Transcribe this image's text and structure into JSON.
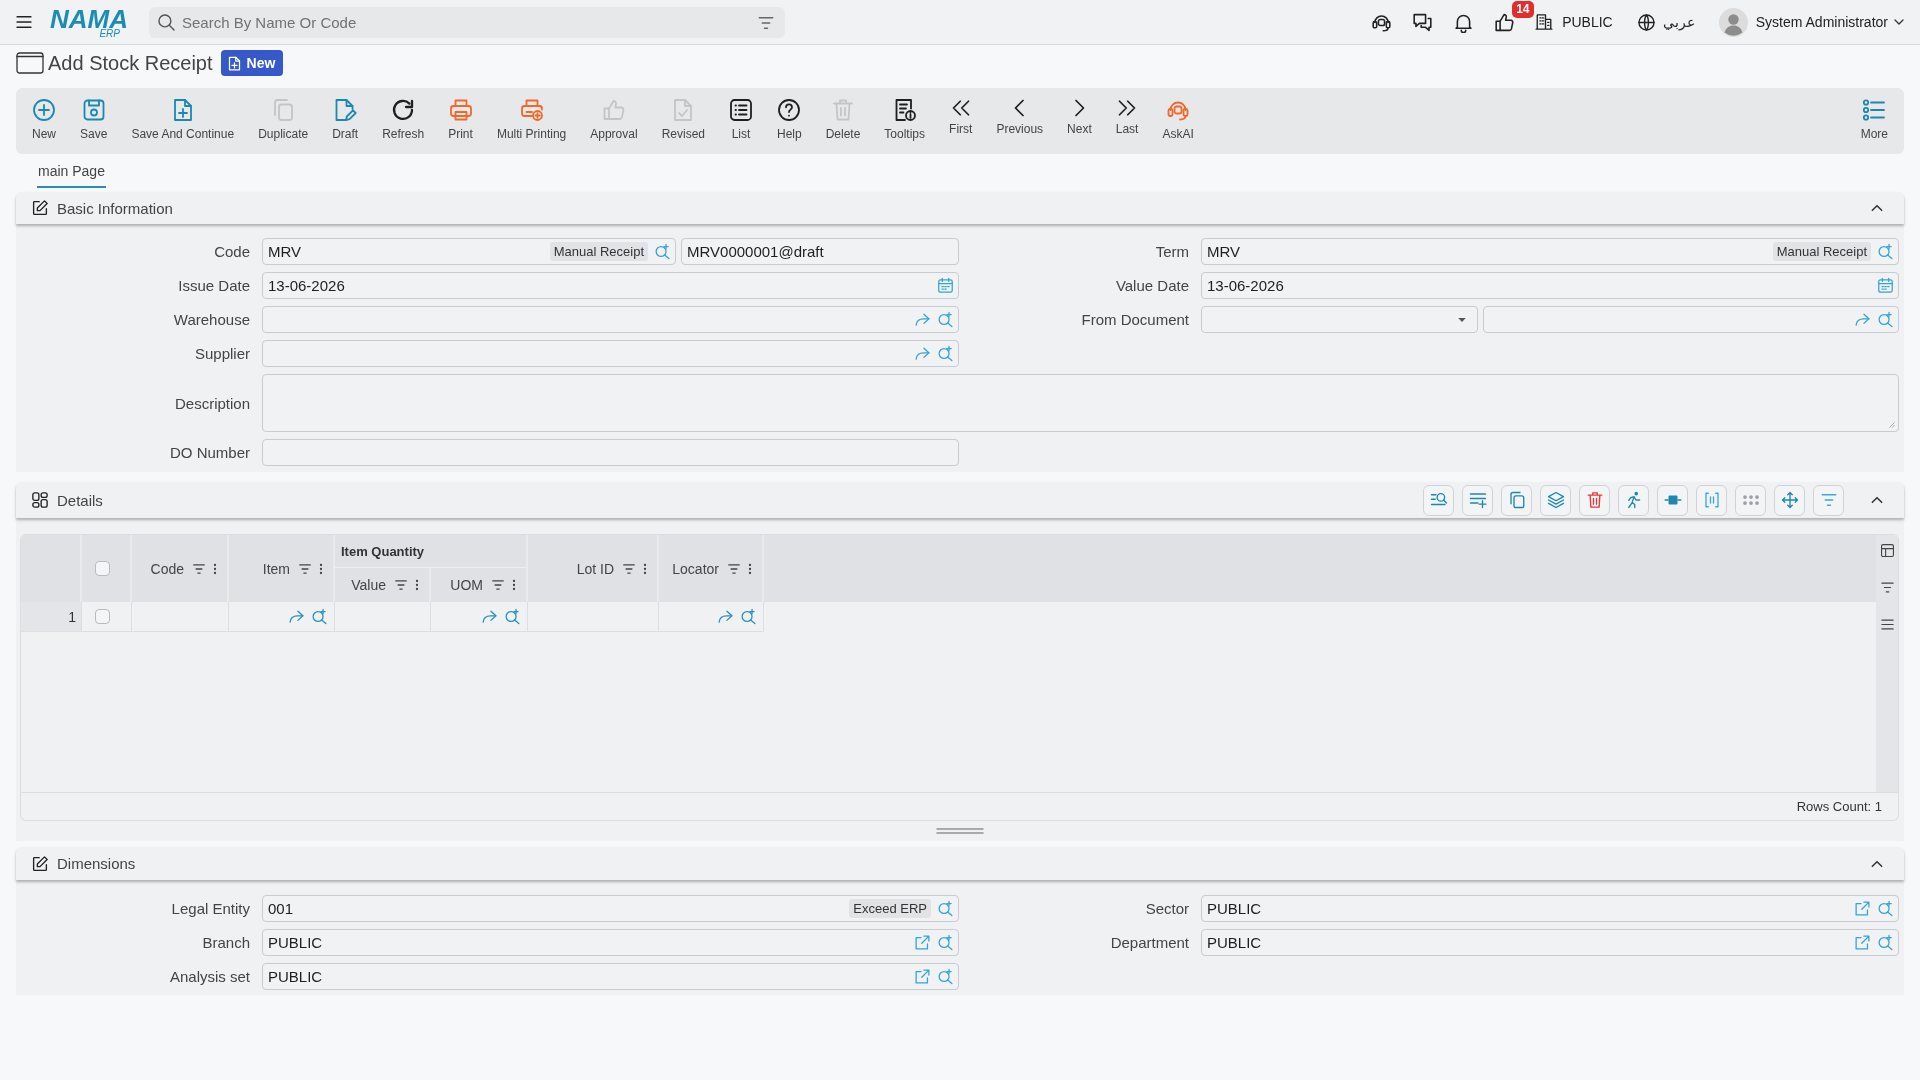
{
  "top_bar": {
    "logo": {
      "name": "NAMA",
      "suffix": "ERP"
    },
    "search": {
      "placeholder": "Search By Name Or Code"
    },
    "notification_count": "14",
    "company": "PUBLIC",
    "language": "عربي",
    "user": "System Administrator"
  },
  "page_header": {
    "title": "Add Stock Receipt",
    "status": "New"
  },
  "toolbar": {
    "actions": [
      {
        "label": "New",
        "disabled": false
      },
      {
        "label": "Save",
        "disabled": false
      },
      {
        "label": "Save And Continue",
        "disabled": false
      },
      {
        "label": "Duplicate",
        "disabled": true
      },
      {
        "label": "Draft",
        "disabled": false
      },
      {
        "label": "Refresh",
        "disabled": false
      },
      {
        "label": "Print",
        "disabled": false
      },
      {
        "label": "Multi Printing",
        "disabled": false
      },
      {
        "label": "Approval",
        "disabled": true
      },
      {
        "label": "Revised",
        "disabled": true
      },
      {
        "label": "List",
        "disabled": false
      },
      {
        "label": "Help",
        "disabled": false
      },
      {
        "label": "Delete",
        "disabled": true
      },
      {
        "label": "Tooltips",
        "disabled": false
      },
      {
        "label": "First",
        "disabled": false
      },
      {
        "label": "Previous",
        "disabled": false
      },
      {
        "label": "Next",
        "disabled": false
      },
      {
        "label": "Last",
        "disabled": false
      },
      {
        "label": "AskAI",
        "disabled": false
      }
    ],
    "more": {
      "label": "More"
    }
  },
  "tabs": [
    {
      "label": "main Page",
      "selected": true
    }
  ],
  "basic_information": {
    "title": "Basic Information",
    "expanded": true,
    "rows": [
      {
        "fields": [
          {
            "label": "Code",
            "kind": "lookup",
            "value": "MRV",
            "tag": "Manual Receipt",
            "number": "MRV0000001@draft"
          },
          {
            "label": "Term",
            "kind": "lookup",
            "value": "MRV",
            "tag": "Manual Receipt"
          }
        ]
      },
      {
        "fields": [
          {
            "label": "Issue Date",
            "kind": "date",
            "value": "13-06-2026"
          },
          {
            "label": "Value Date",
            "kind": "date",
            "value": "13-06-2026"
          }
        ]
      },
      {
        "fields": [
          {
            "label": "Warehouse",
            "kind": "link_lookup"
          },
          {
            "label": "From Document",
            "kind": "document"
          }
        ]
      },
      {
        "fields": [
          {
            "label": "Supplier",
            "kind": "link_lookup"
          }
        ]
      },
      {
        "fields": [
          {
            "label": "Description",
            "kind": "textarea"
          }
        ]
      },
      {
        "fields": [
          {
            "label": "DO Number",
            "kind": "text"
          }
        ]
      }
    ]
  },
  "details": {
    "title": "Details",
    "expanded": true,
    "grid": {
      "columns": [
        {
          "label": "Code",
          "kind": "text"
        },
        {
          "label": "Item",
          "kind": "lookup"
        },
        {
          "label": "Item Quantity",
          "children": [
            {
              "label": "Value",
              "kind": "text"
            },
            {
              "label": "UOM",
              "kind": "lookup"
            }
          ]
        },
        {
          "label": "Lot ID",
          "kind": "text"
        },
        {
          "label": "Locator",
          "kind": "lookup"
        }
      ],
      "all_selected": false,
      "rows": [
        {
          "number": "1",
          "selected": false
        }
      ],
      "rows_count": "Rows Count: 1"
    }
  },
  "dimensions": {
    "title": "Dimensions",
    "expanded": true,
    "rows": [
      {
        "fields": [
          {
            "label": "Legal Entity",
            "kind": "lookup",
            "value": "001",
            "tag": "Exceed ERP"
          },
          {
            "label": "Sector",
            "kind": "open_lookup",
            "value": "PUBLIC"
          }
        ]
      },
      {
        "fields": [
          {
            "label": "Branch",
            "kind": "open_lookup",
            "value": "PUBLIC"
          },
          {
            "label": "Department",
            "kind": "open_lookup",
            "value": "PUBLIC"
          }
        ]
      },
      {
        "fields": [
          {
            "label": "Analysis set",
            "kind": "open_lookup",
            "value": "PUBLIC"
          }
        ]
      }
    ]
  }
}
